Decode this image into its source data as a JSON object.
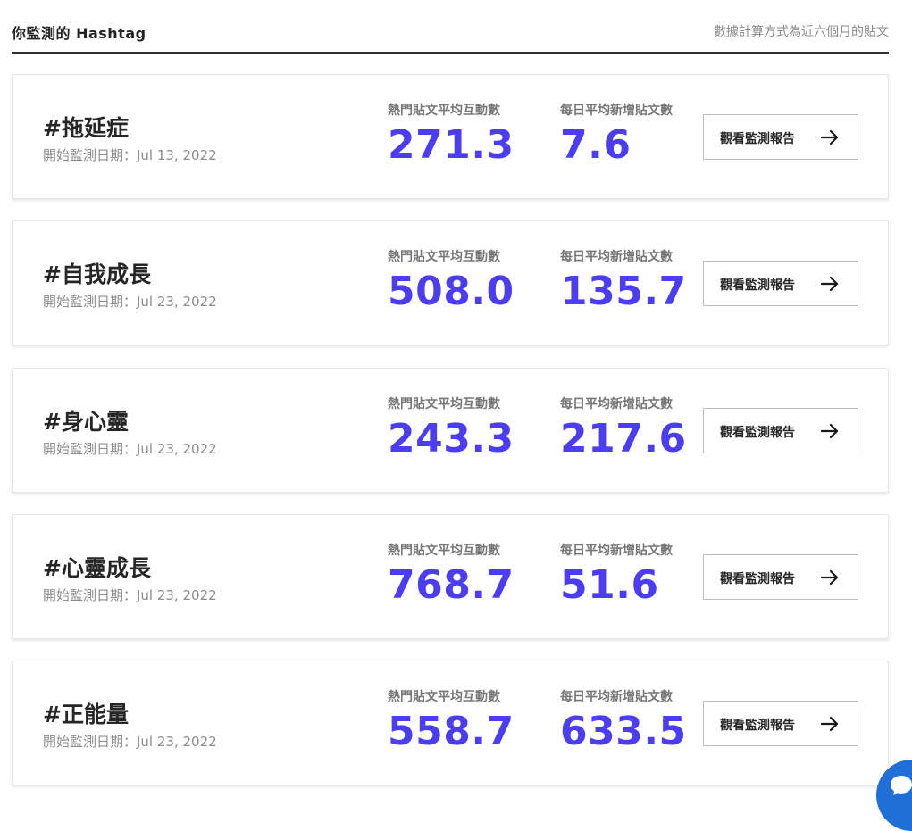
{
  "header": {
    "title": "你監測的 Hashtag",
    "note": "數據計算方式為近六個月的貼文"
  },
  "cards": [
    {
      "tag": "#拖延症",
      "date": "開始監測日期：Jul 13, 2022",
      "metric1_label": "熱門貼文平均互動數",
      "metric1_value": "271.3",
      "metric2_label": "每日平均新增貼文數",
      "metric2_value": "7.6",
      "button_label": "觀看監測報告"
    },
    {
      "tag": "#自我成長",
      "date": "開始監測日期：Jul 23, 2022",
      "metric1_label": "熱門貼文平均互動數",
      "metric1_value": "508.0",
      "metric2_label": "每日平均新增貼文數",
      "metric2_value": "135.7",
      "button_label": "觀看監測報告"
    },
    {
      "tag": "#身心靈",
      "date": "開始監測日期：Jul 23, 2022",
      "metric1_label": "熱門貼文平均互動數",
      "metric1_value": "243.3",
      "metric2_label": "每日平均新增貼文數",
      "metric2_value": "217.6",
      "button_label": "觀看監測報告"
    },
    {
      "tag": "#心靈成長",
      "date": "開始監測日期：Jul 23, 2022",
      "metric1_label": "熱門貼文平均互動數",
      "metric1_value": "768.7",
      "metric2_label": "每日平均新增貼文數",
      "metric2_value": "51.6",
      "button_label": "觀看監測報告"
    },
    {
      "tag": "#正能量",
      "date": "開始監測日期：Jul 23, 2022",
      "metric1_label": "熱門貼文平均互動數",
      "metric1_value": "558.7",
      "metric2_label": "每日平均新增貼文數",
      "metric2_value": "633.5",
      "button_label": "觀看監測報告"
    }
  ],
  "icons": {
    "button_icon": "arrow-right-icon",
    "chat_icon": "chat-icon"
  },
  "colors": {
    "metric_value": "#4b3df2",
    "chat_bubble": "#1f6fd6"
  }
}
